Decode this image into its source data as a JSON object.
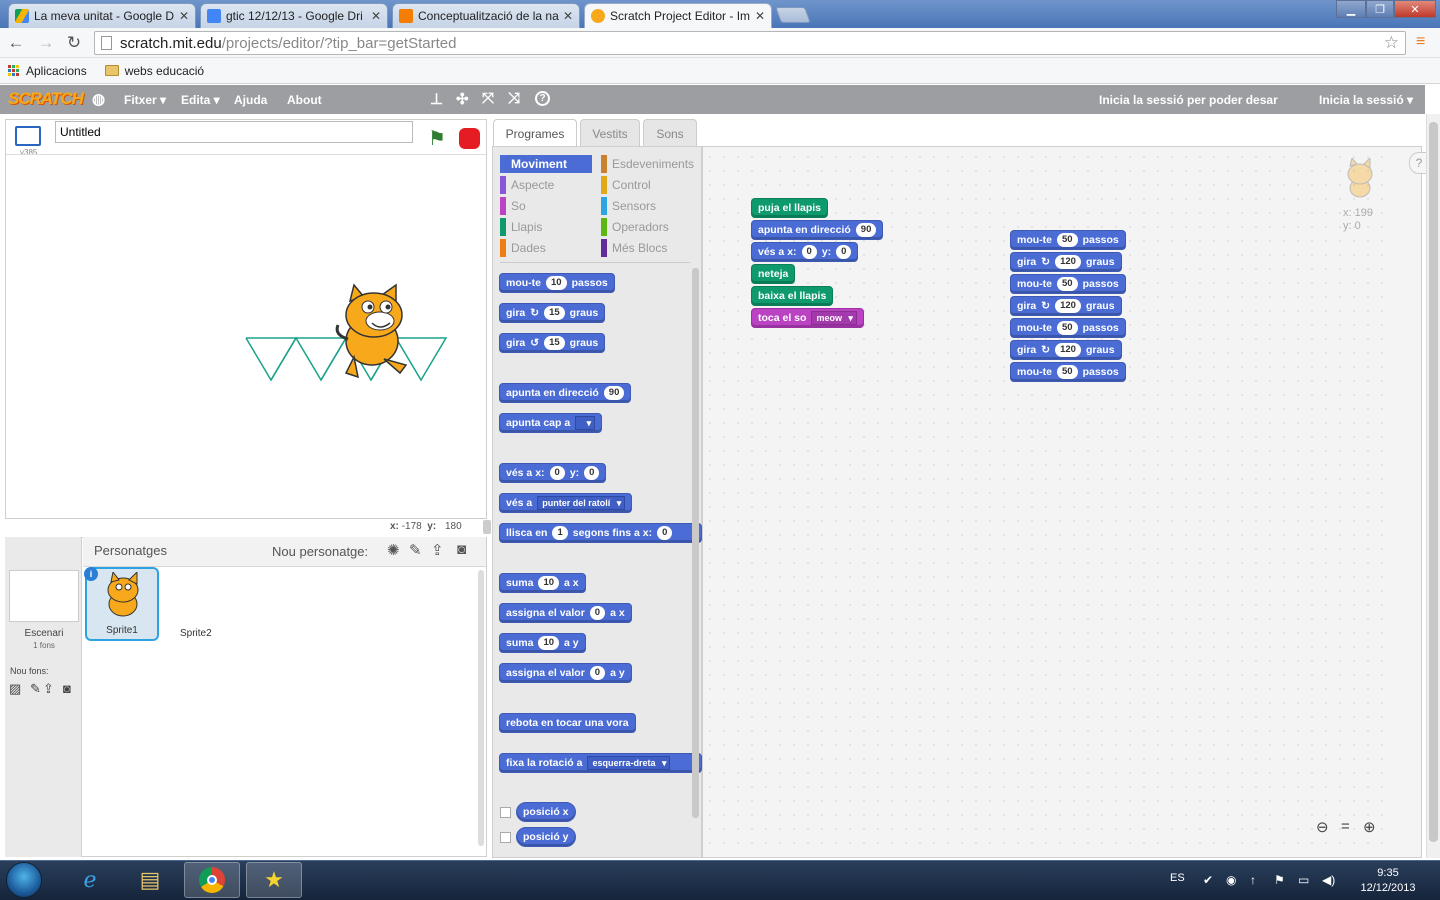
{
  "browser": {
    "tabs": [
      {
        "label": "La meva unitat - Google D",
        "icon": "drive-icon",
        "color": "#f4b400"
      },
      {
        "label": "gtic 12/12/13 - Google Dri",
        "icon": "docs-icon",
        "color": "#4285f4"
      },
      {
        "label": "Conceptualització de la na",
        "icon": "blogger-icon",
        "color": "#f57d00"
      },
      {
        "label": "Scratch Project Editor - Im",
        "icon": "scratch-icon",
        "color": "#f7a81b"
      }
    ],
    "url_host": "scratch.mit.edu",
    "url_path": "/projects/editor/?tip_bar=getStarted",
    "bookmarks": [
      "Aplicacions",
      "webs educació"
    ]
  },
  "scratch": {
    "logo": "SCRATCH",
    "menus": [
      "Fitxer ▾",
      "Edita ▾",
      "Ajuda",
      "About"
    ],
    "signin_save": "Inicia la sessió per poder desar",
    "signin": "Inicia la sessió ▾",
    "project_title": "Untitled",
    "version": "v385",
    "mouse_x_label": "x:",
    "mouse_x": "-178",
    "mouse_y_label": "y:",
    "mouse_y": "180",
    "tabs": [
      "Programes",
      "Vestits",
      "Sons"
    ],
    "categories_left": [
      {
        "label": "Moviment",
        "color": "#4a6cd4",
        "selected": true
      },
      {
        "label": "Aspecte",
        "color": "#8a55d7"
      },
      {
        "label": "So",
        "color": "#bb42c3"
      },
      {
        "label": "Llapis",
        "color": "#0e9a6c"
      },
      {
        "label": "Dades",
        "color": "#ee7d16"
      }
    ],
    "categories_right": [
      {
        "label": "Esdeveniments",
        "color": "#c88330"
      },
      {
        "label": "Control",
        "color": "#e1a91a"
      },
      {
        "label": "Sensors",
        "color": "#2ca5e2"
      },
      {
        "label": "Operadors",
        "color": "#5cb712"
      },
      {
        "label": "Més Blocs",
        "color": "#632d99"
      }
    ],
    "palette": {
      "move": [
        "mou-te",
        "10",
        "passos"
      ],
      "turn_right": [
        "gira",
        "15",
        "graus"
      ],
      "turn_left": [
        "gira",
        "15",
        "graus"
      ],
      "point_dir": [
        "apunta en direcció",
        "90"
      ],
      "point_towards": [
        "apunta cap a"
      ],
      "goto_xy": [
        "vés a x:",
        "0",
        "y:",
        "0"
      ],
      "goto": [
        "vés a",
        "punter del ratolí"
      ],
      "glide": [
        "llisca en",
        "1",
        "segons fins a x:",
        "0"
      ],
      "change_x": [
        "suma",
        "10",
        "a x"
      ],
      "set_x": [
        "assigna el valor",
        "0",
        "a x"
      ],
      "change_y": [
        "suma",
        "10",
        "a y"
      ],
      "set_y": [
        "assigna el valor",
        "0",
        "a y"
      ],
      "bounce": "rebota en tocar una vora",
      "rotation": [
        "fixa la rotació a",
        "esquerra-dreta"
      ],
      "xpos": "posició x",
      "ypos": "posició y"
    },
    "script1": {
      "pen_up": "puja el llapis",
      "point": [
        "apunta en direcció",
        "90"
      ],
      "goto": [
        "vés a x:",
        "0",
        "y:",
        "0"
      ],
      "clear": "neteja",
      "pen_down": "baixa el llapis",
      "sound": [
        "toca el so",
        "meow"
      ]
    },
    "script2": [
      [
        "mou-te",
        "50",
        "passos"
      ],
      [
        "gira",
        "120",
        "graus"
      ],
      [
        "mou-te",
        "50",
        "passos"
      ],
      [
        "gira",
        "120",
        "graus"
      ],
      [
        "mou-te",
        "50",
        "passos"
      ],
      [
        "gira",
        "120",
        "graus"
      ],
      [
        "mou-te",
        "50",
        "passos"
      ]
    ],
    "sprite_info": {
      "x": "x: 199",
      "y": "y: 0"
    },
    "sprites_header": "Personatges",
    "new_sprite": "Nou personatge:",
    "stage_label": "Escenari",
    "stage_backdrops": "1 fons",
    "new_backdrop": "Nou fons:",
    "sprites": [
      "Sprite1",
      "Sprite2"
    ]
  },
  "taskbar": {
    "lang": "ES",
    "time": "9:35",
    "date": "12/12/2013"
  }
}
